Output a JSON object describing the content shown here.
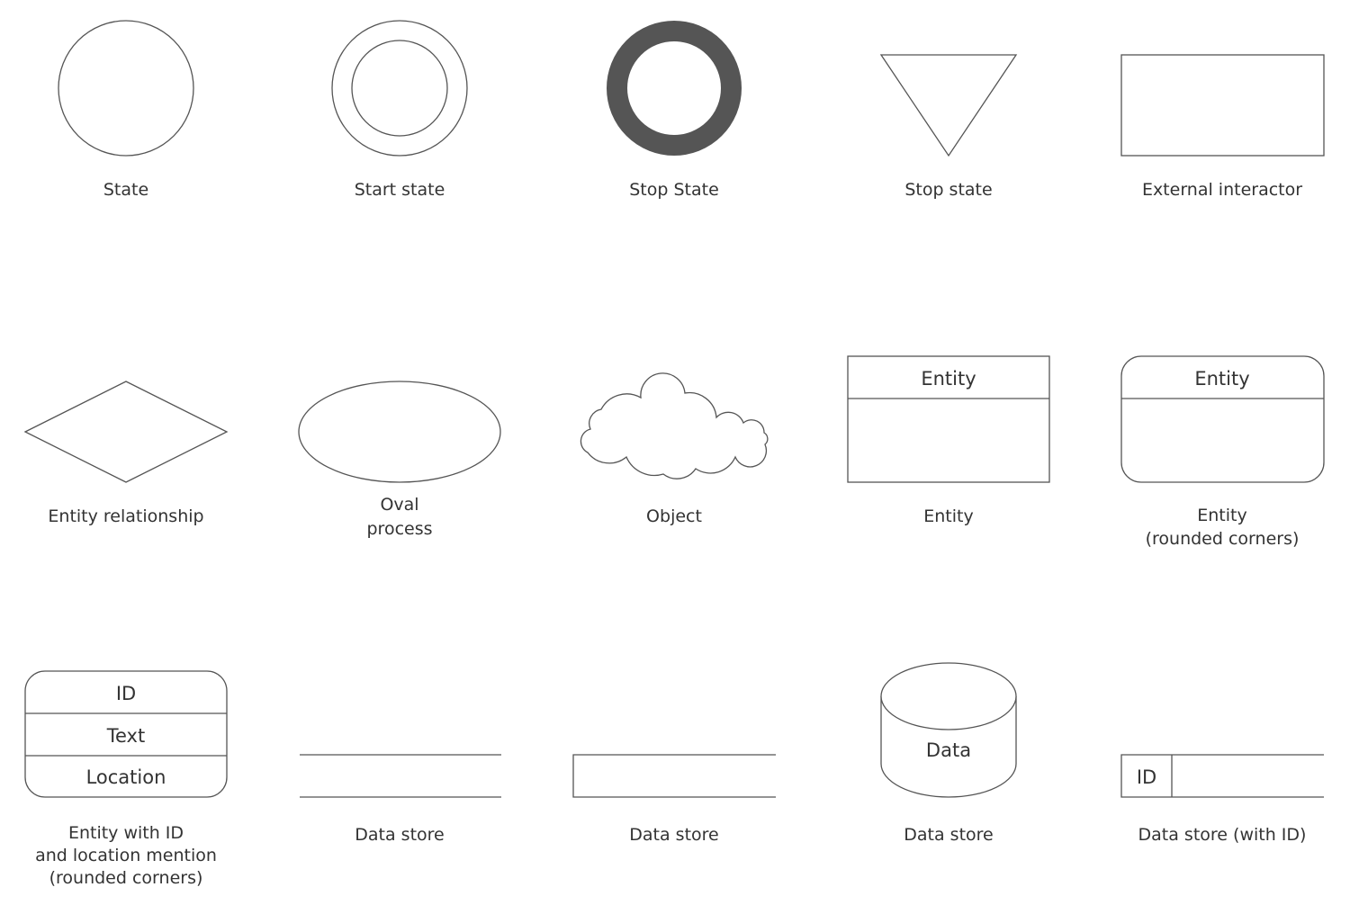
{
  "colors": {
    "stroke": "#555555",
    "stop_state_fill": "#555555",
    "text": "#333333"
  },
  "shapes": [
    {
      "label": [
        "State"
      ]
    },
    {
      "label": [
        "Start state"
      ]
    },
    {
      "label": [
        "Stop State"
      ]
    },
    {
      "label": [
        "Stop state"
      ]
    },
    {
      "label": [
        "External interactor"
      ]
    },
    {
      "label": [
        "Entity relationship"
      ]
    },
    {
      "label": [
        "Oval",
        "process"
      ]
    },
    {
      "label": [
        "Object"
      ]
    },
    {
      "label": [
        "Entity"
      ],
      "inner": [
        "Entity"
      ]
    },
    {
      "label": [
        "Entity",
        "(rounded corners)"
      ],
      "inner": [
        "Entity"
      ]
    },
    {
      "label": [
        "Entity with ID",
        "and location mention",
        "(rounded corners)"
      ],
      "inner": [
        "ID",
        "Text",
        "Location"
      ]
    },
    {
      "label": [
        "Data store"
      ]
    },
    {
      "label": [
        "Data store"
      ]
    },
    {
      "label": [
        "Data store"
      ],
      "inner": [
        "Data"
      ]
    },
    {
      "label": [
        "Data store (with ID)"
      ],
      "inner": [
        "ID"
      ]
    }
  ]
}
